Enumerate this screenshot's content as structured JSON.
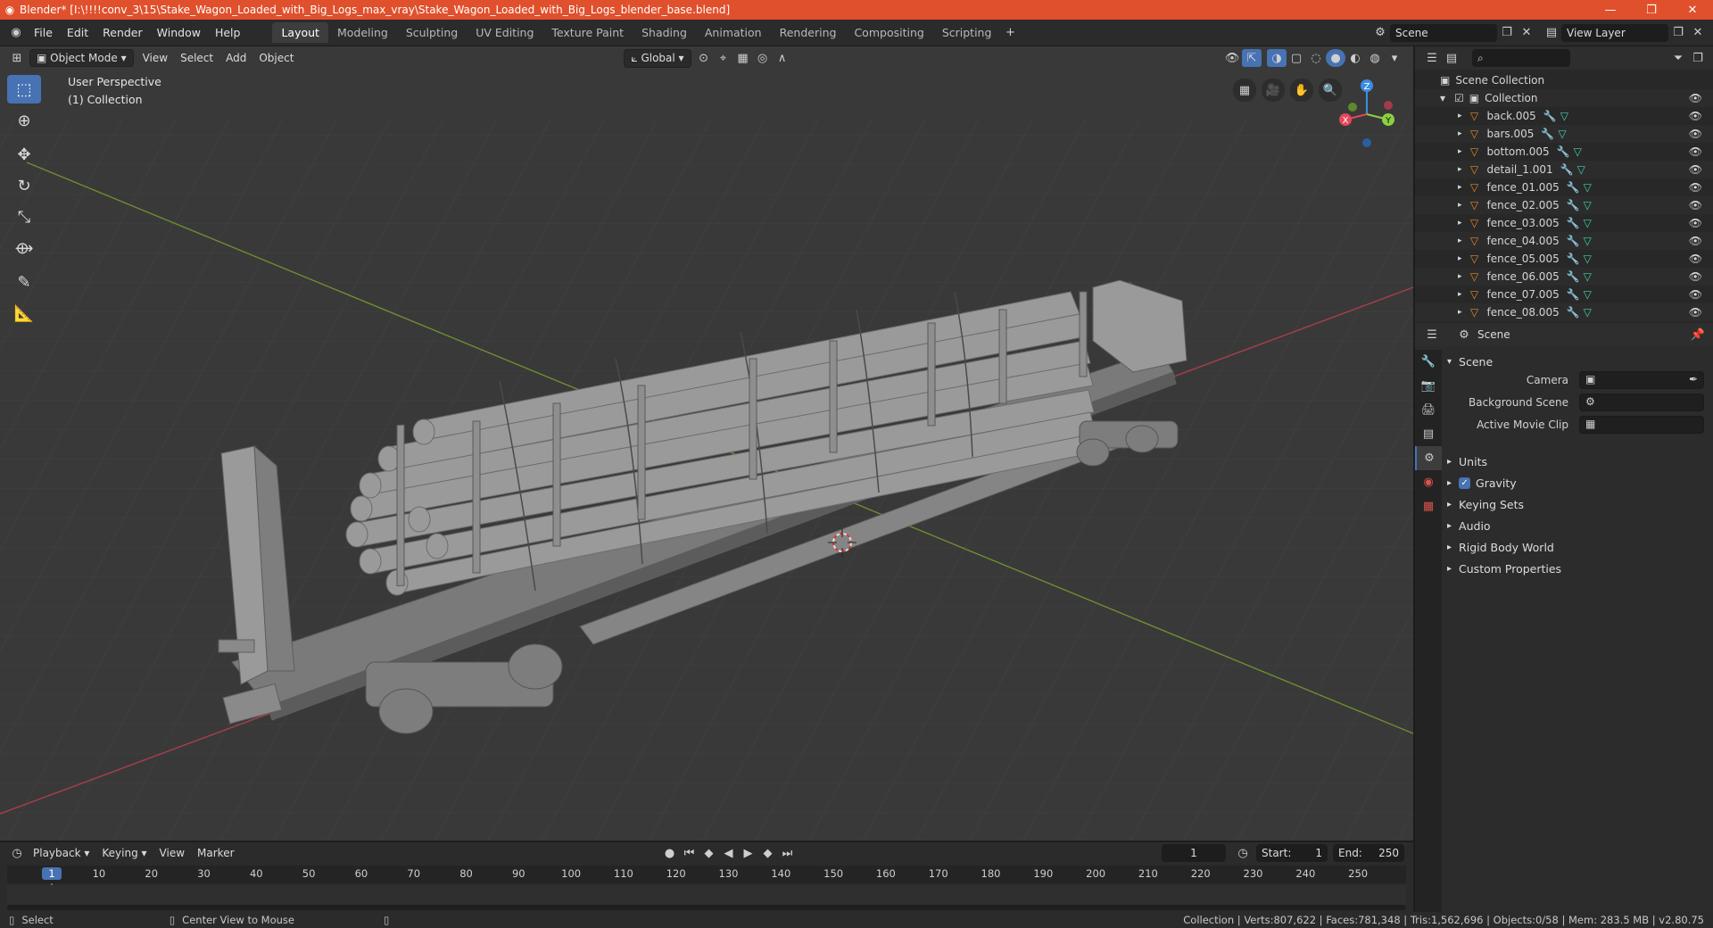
{
  "window": {
    "title": "Blender* [I:\\!!!!conv_3\\15\\Stake_Wagon_Loaded_with_Big_Logs_max_vray\\Stake_Wagon_Loaded_with_Big_Logs_blender_base.blend]",
    "titlebar_color": "#e0502c"
  },
  "menu": {
    "items": [
      "File",
      "Edit",
      "Render",
      "Window",
      "Help"
    ]
  },
  "workspaces": {
    "tabs": [
      "Layout",
      "Modeling",
      "Sculpting",
      "UV Editing",
      "Texture Paint",
      "Shading",
      "Animation",
      "Rendering",
      "Compositing",
      "Scripting"
    ],
    "active": "Layout"
  },
  "scene_selector": {
    "value": "Scene"
  },
  "view_layer_selector": {
    "value": "View Layer"
  },
  "viewport": {
    "mode": "Object Mode",
    "menus": [
      "View",
      "Select",
      "Add",
      "Object"
    ],
    "orientation": "Global",
    "overlay_title": "User Perspective",
    "overlay_collection": "(1) Collection",
    "gizmo": {
      "x": "X",
      "y": "Y",
      "z": "Z"
    },
    "background": "#393939"
  },
  "outliner": {
    "root": "Scene Collection",
    "collection": "Collection",
    "objects": [
      "back.005",
      "bars.005",
      "bottom.005",
      "detail_1.001",
      "fence_01.005",
      "fence_02.005",
      "fence_03.005",
      "fence_04.005",
      "fence_05.005",
      "fence_06.005",
      "fence_07.005",
      "fence_08.005"
    ]
  },
  "properties": {
    "header": "Scene",
    "panel_title": "Scene",
    "fields": {
      "camera": "Camera",
      "background_scene": "Background Scene",
      "active_movie_clip": "Active Movie Clip"
    },
    "sections": [
      "Units",
      "Gravity",
      "Keying Sets",
      "Audio",
      "Rigid Body World",
      "Custom Properties"
    ],
    "gravity_checked": true
  },
  "timeline": {
    "menus": [
      "Playback",
      "Keying",
      "View",
      "Marker"
    ],
    "current_frame": "1",
    "start_label": "Start:",
    "start": "1",
    "end_label": "End:",
    "end": "250",
    "ruler": [
      "1",
      "10",
      "20",
      "30",
      "40",
      "50",
      "60",
      "70",
      "80",
      "90",
      "100",
      "110",
      "120",
      "130",
      "140",
      "150",
      "160",
      "170",
      "180",
      "190",
      "200",
      "210",
      "220",
      "230",
      "240",
      "250"
    ]
  },
  "statusbar": {
    "left": "Select",
    "middle": "Center View to Mouse",
    "stats": "Collection | Verts:807,622 | Faces:781,348 | Tris:1,562,696 | Objects:0/58 | Mem: 283.5 MB | v2.80.75"
  },
  "colors": {
    "accent": "#4772b3",
    "axis_x": "#e8475b",
    "axis_y": "#8bd13f",
    "axis_z": "#3b8de4",
    "mesh_icon": "#e8862b"
  }
}
